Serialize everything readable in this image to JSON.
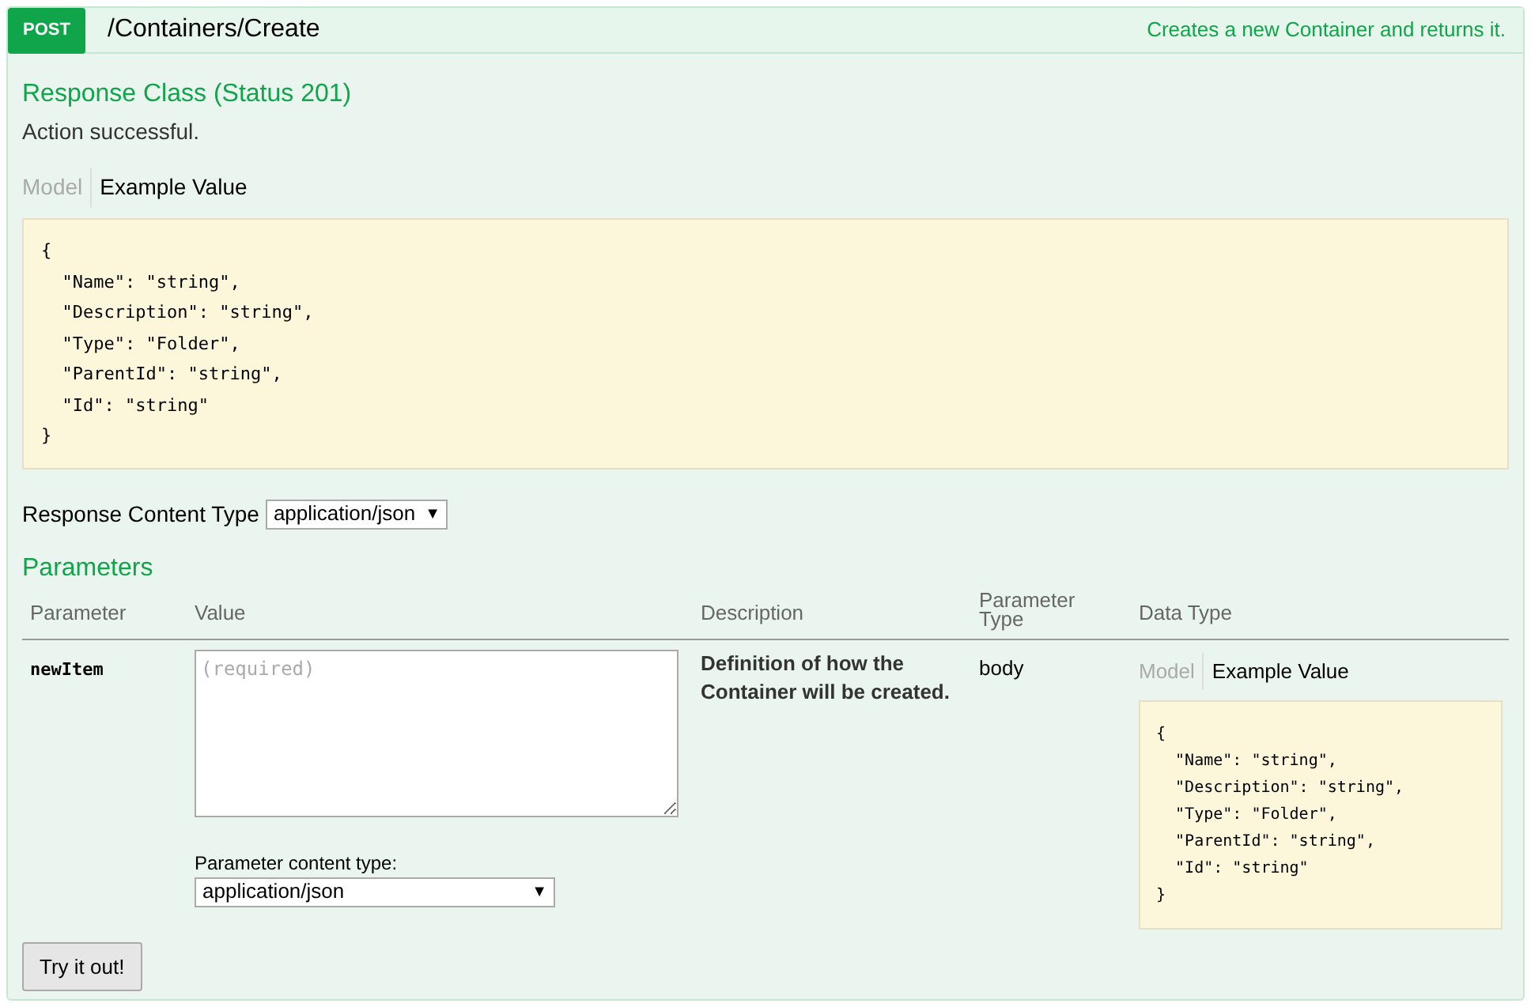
{
  "operation": {
    "method": "POST",
    "path": "/Containers/Create",
    "summary": "Creates a new Container and returns it."
  },
  "response_class": {
    "title": "Response Class (Status 201)",
    "message": "Action successful.",
    "tabs": [
      {
        "label": "Model",
        "selected": false
      },
      {
        "label": "Example Value",
        "selected": true
      }
    ],
    "example": [
      "{",
      "  \"Name\": \"string\",",
      "  \"Description\": \"string\",",
      "  \"Type\": \"Folder\",",
      "  \"ParentId\": \"string\",",
      "  \"Id\": \"string\"",
      "}"
    ]
  },
  "response_content_type": {
    "label": "Response Content Type",
    "value": "application/json",
    "arrow": "▼"
  },
  "parameters": {
    "title": "Parameters",
    "columns": [
      "Parameter",
      "Value",
      "Description",
      "Parameter Type",
      "Data Type"
    ],
    "rows": [
      {
        "name": "newItem",
        "placeholder": "(required)",
        "content_type_label": "Parameter content type:",
        "content_type": "application/json",
        "arrow": "▼",
        "description": "Definition of how the Container will be created.",
        "parameter_type": "body",
        "tabs": [
          {
            "label": "Model",
            "selected": false
          },
          {
            "label": "Example Value",
            "selected": true
          }
        ],
        "example": [
          "{",
          "  \"Name\": \"string\",",
          "  \"Description\": \"string\",",
          "  \"Type\": \"Folder\",",
          "  \"ParentId\": \"string\",",
          "  \"Id\": \"string\"",
          "}"
        ]
      }
    ]
  },
  "submit": "Try it out!"
}
